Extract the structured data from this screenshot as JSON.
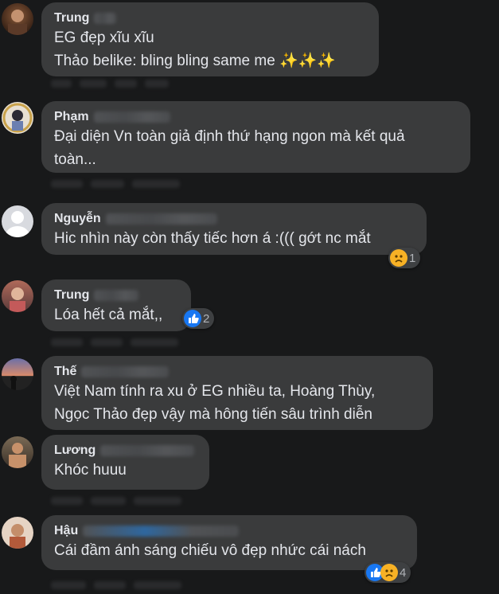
{
  "comments": [
    {
      "author": "Trung",
      "text": "EG đẹp xĩu xĩu\nThảo belike: bling bling same me ✨✨✨",
      "reactions": [],
      "count": ""
    },
    {
      "author": "Phạm",
      "text": "Đại diện Vn toàn giả định thứ hạng ngon mà kết quả\ntoàn...",
      "reactions": [],
      "count": ""
    },
    {
      "author": "Nguyễn",
      "text": "Hic nhìn này còn thấy tiếc hơn á :((( gớt nc mắt",
      "reactions": [
        "sad"
      ],
      "count": "1"
    },
    {
      "author": "Trung",
      "text": "Lóa hết cả mắt,,",
      "reactions": [
        "like"
      ],
      "count": "2"
    },
    {
      "author": "Thế",
      "text": "Việt Nam tính ra xu ở EG nhiều ta, Hoàng Thùy,\nNgọc Thảo đẹp vậy mà hông tiến sâu trình diễn",
      "reactions": [],
      "count": ""
    },
    {
      "author": "Lương",
      "text": "Khóc huuu",
      "reactions": [],
      "count": ""
    },
    {
      "author": "Hậu",
      "text": "Cái đầm ánh sáng chiếu vô đẹp nhức cái nách",
      "reactions": [
        "like",
        "sad"
      ],
      "count": "4"
    }
  ],
  "colors": {
    "background": "#18191a",
    "bubble": "#3a3b3c",
    "text": "#e4e6eb",
    "like": "#1877f2",
    "sad": "#f7b125"
  }
}
